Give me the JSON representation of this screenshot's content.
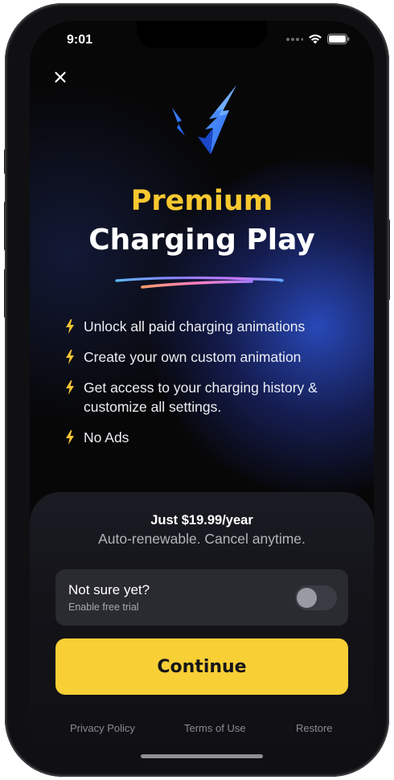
{
  "status_bar": {
    "time": "9:01",
    "icons": [
      "signal-dots-icon",
      "wifi-icon",
      "battery-icon"
    ]
  },
  "close_icon": "close-icon",
  "logo_icon": "lightning-check-logo",
  "header": {
    "title_line1": "Premium",
    "title_line2": "Charging Play"
  },
  "features": [
    {
      "icon": "bolt-icon",
      "text": "Unlock all paid charging animations"
    },
    {
      "icon": "bolt-icon",
      "text": "Create your own custom animation"
    },
    {
      "icon": "bolt-icon",
      "text": "Get access to your charging history & customize all settings."
    },
    {
      "icon": "bolt-icon",
      "text": "No Ads"
    }
  ],
  "pricing": {
    "price": "Just $19.99/year",
    "subtitle": "Auto-renewable. Cancel anytime."
  },
  "trial": {
    "title": "Not sure yet?",
    "subtitle": "Enable free trial",
    "toggle_on": false
  },
  "cta": {
    "label": "Continue"
  },
  "footer": {
    "privacy": "Privacy Policy",
    "terms": "Terms of Use",
    "restore": "Restore"
  },
  "colors": {
    "accent_yellow": "#F8CF35",
    "title_yellow": "#F8C82F",
    "background": "#070708",
    "glow_blue": "#2E54D6",
    "card": "#2A2A31"
  }
}
